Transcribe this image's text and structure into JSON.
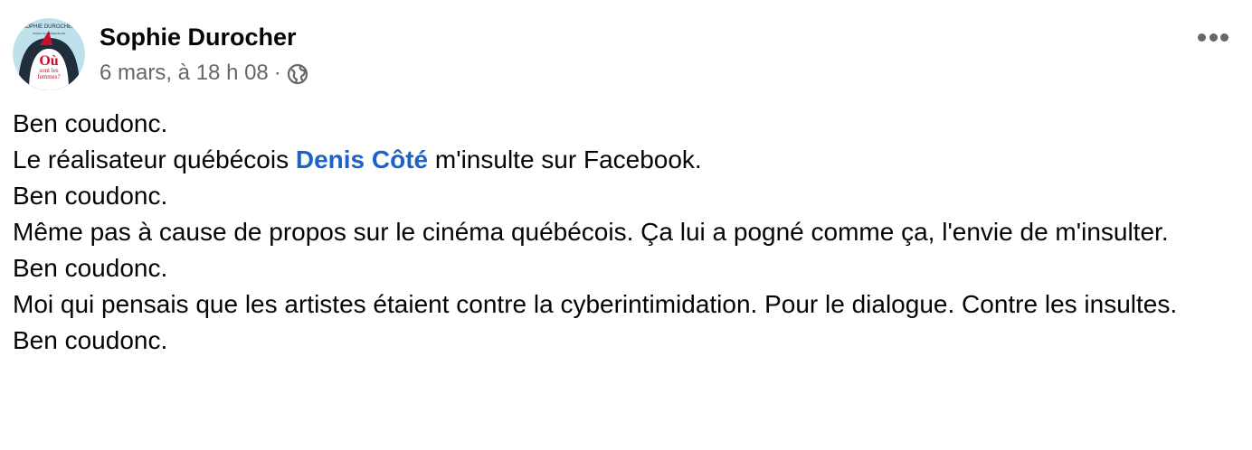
{
  "author": {
    "name": "Sophie Durocher"
  },
  "avatar": {
    "top_text": "SOPHIE DUROCHER",
    "sub_text": "Préface de Nathalie Bondil",
    "logo_line1": "Où",
    "logo_line2": "sont les",
    "logo_line3": "femmes?",
    "bg_color": "#bfe1ec",
    "accent_color": "#c8102e",
    "dark_color": "#1f2d3d"
  },
  "meta": {
    "timestamp": "6 mars, à 18 h 08",
    "separator": "·",
    "audience_icon": "globe-icon"
  },
  "actions": {
    "more_icon": "more-options-icon"
  },
  "colors": {
    "mention": "#1b63c9",
    "secondary_text": "#65676b"
  },
  "post": {
    "line1": "Ben coudonc.",
    "line2_before": "Le réalisateur québécois ",
    "line2_mention": "Denis Côté",
    "line2_after": " m'insulte sur Facebook.",
    "line3": "Ben coudonc.",
    "line4": "Même pas à cause de propos sur le cinéma québécois. Ça lui a pogné comme ça, l'envie de m'insulter.",
    "line5": "Ben coudonc.",
    "line6": "Moi qui pensais que les artistes étaient contre la cyberintimidation. Pour le dialogue. Contre les insultes.",
    "line7": "Ben coudonc."
  }
}
